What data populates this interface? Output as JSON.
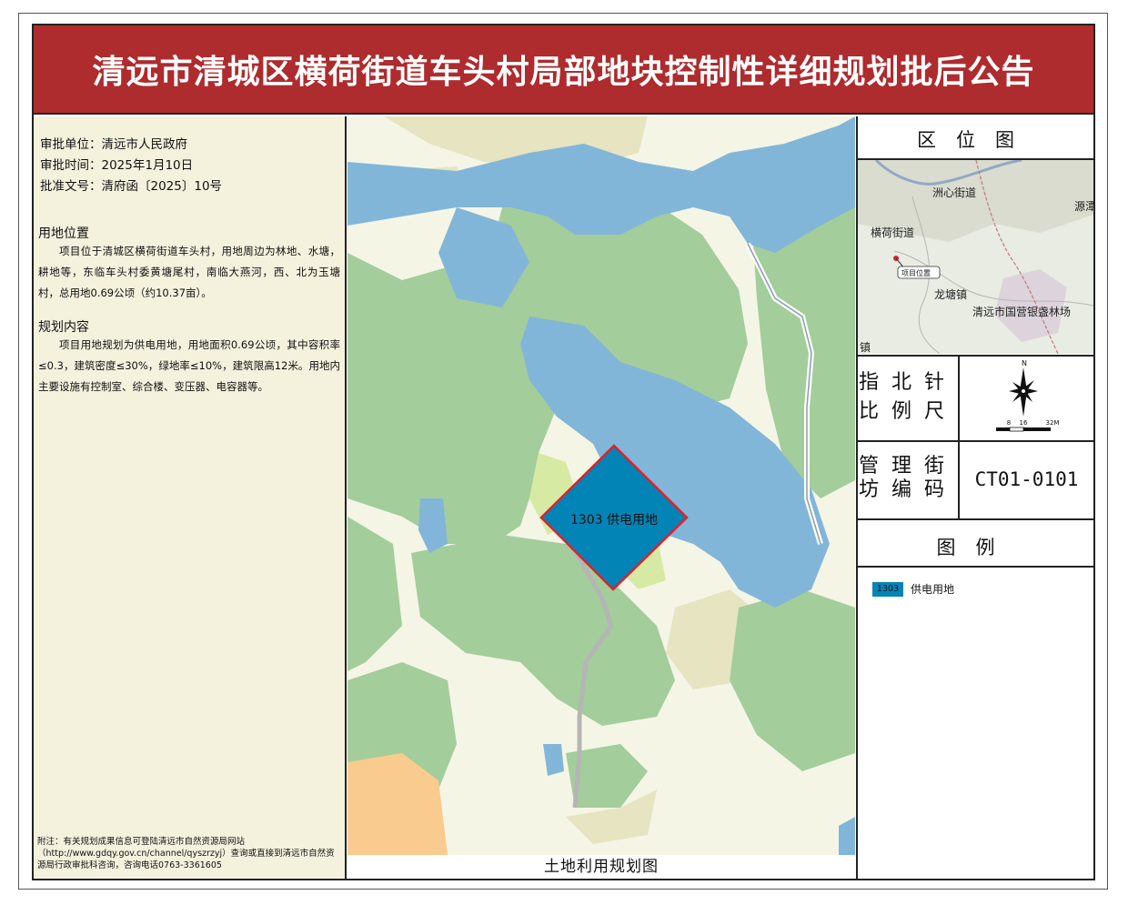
{
  "title": "清远市清城区横荷街道车头村局部地块控制性详细规划批后公告",
  "approval": {
    "unit_label": "审批单位：",
    "unit_value": "清远市人民政府",
    "date_label": "审批时间：",
    "date_value": "2025年1月10日",
    "doc_label": "批准文号：",
    "doc_value": "清府函〔2025〕10号"
  },
  "location": {
    "heading": "用地位置",
    "text": "项目位于清城区横荷街道车头村，用地周边为林地、水塘，耕地等，东临车头村委黄塘尾村，南临大燕河，西、北为玉塘村，总用地0.69公顷（约10.37亩）。"
  },
  "plan": {
    "heading": "规划内容",
    "text": "项目用地规划为供电用地，用地面积0.69公顷，其中容积率≤0.3，建筑密度≤30%，绿地率≤10%，建筑限高12米。用地内主要设施有控制室、综合楼、变压器、电容器等。"
  },
  "footnote": "附注：有关规划成果信息可登陆清远市自然资源局网站（http://www.gdqy.gov.cn/channel/qyszrzyj）查询或直接到清远市自然资源局行政审批科咨询，咨询电话0763-3361605",
  "map": {
    "caption": "土地利用规划图",
    "parcel_code": "1303",
    "parcel_use": "供电用地"
  },
  "location_map": {
    "title": "区位图",
    "labels": [
      "洲心街道",
      "源潭",
      "横荷街道",
      "项目位置",
      "龙塘镇",
      "清远市国营银盏林场",
      "镇"
    ]
  },
  "north_scale": {
    "label_line1": "指北针",
    "label_line2": "比例尺",
    "north_letter": "N",
    "scale_ticks": [
      "8",
      "16",
      "32M"
    ]
  },
  "block": {
    "label_line1": "管理街",
    "label_line2": "坊编码",
    "code": "CT01-0101"
  },
  "legend": {
    "title": "图例",
    "items": [
      {
        "code": "1303",
        "label": "供电用地",
        "color": "#0284b6"
      }
    ]
  },
  "colors": {
    "title_bg": "#ae2b2e",
    "water": "#82b6d8",
    "forest": "#a3cd9b",
    "farmland": "#e6e4c1",
    "power_land": "#0284b6",
    "boundary": "#e0202a"
  }
}
